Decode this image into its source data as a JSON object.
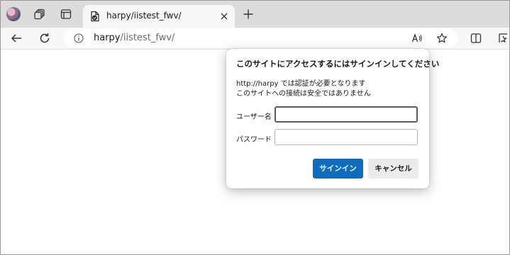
{
  "tab": {
    "title": "harpy/iistest_fwv/"
  },
  "address": {
    "host": "harpy",
    "path": "/iistest_fwv/"
  },
  "dialog": {
    "title": "このサイトにアクセスするにはサインインしてください",
    "message_line1": "http://harpy では認証が必要となります",
    "message_line2": "このサイトへの接続は安全ではありません",
    "username_label": "ユーザー名",
    "password_label": "パスワード",
    "username_value": "",
    "password_value": "",
    "signin_label": "サインイン",
    "cancel_label": "キャンセル"
  },
  "colors": {
    "accent": "#0f6cbd",
    "tabstrip_bg": "#dcdcdc",
    "toolbar_bg": "#f7f7f7"
  }
}
